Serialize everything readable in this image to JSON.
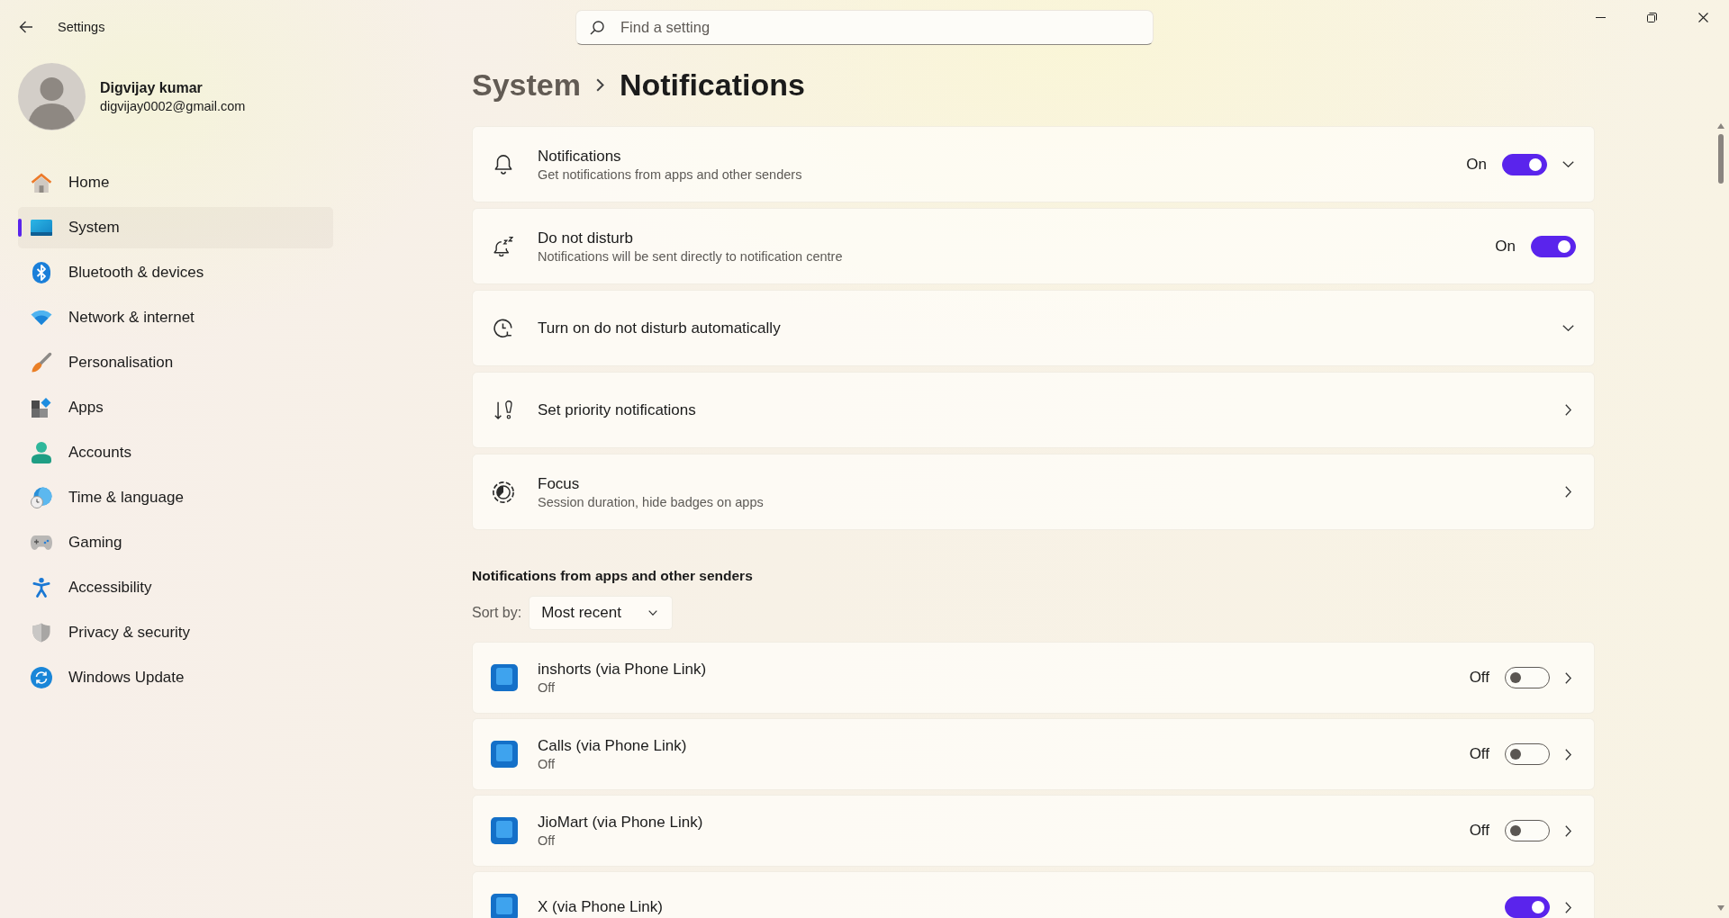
{
  "window": {
    "title": "Settings"
  },
  "search": {
    "placeholder": "Find a setting"
  },
  "account": {
    "name": "Digvijay kumar",
    "email": "digvijay0002@gmail.com"
  },
  "sidebar": {
    "items": [
      {
        "label": "Home",
        "selected": false
      },
      {
        "label": "System",
        "selected": true
      },
      {
        "label": "Bluetooth & devices",
        "selected": false
      },
      {
        "label": "Network & internet",
        "selected": false
      },
      {
        "label": "Personalisation",
        "selected": false
      },
      {
        "label": "Apps",
        "selected": false
      },
      {
        "label": "Accounts",
        "selected": false
      },
      {
        "label": "Time & language",
        "selected": false
      },
      {
        "label": "Gaming",
        "selected": false
      },
      {
        "label": "Accessibility",
        "selected": false
      },
      {
        "label": "Privacy & security",
        "selected": false
      },
      {
        "label": "Windows Update",
        "selected": false
      }
    ]
  },
  "breadcrumb": {
    "parent": "System",
    "current": "Notifications"
  },
  "settings": [
    {
      "kind": "toggle",
      "title": "Notifications",
      "description": "Get notifications from apps and other senders",
      "state_label": "On",
      "on": true,
      "expanded": false
    },
    {
      "kind": "toggle",
      "title": "Do not disturb",
      "description": "Notifications will be sent directly to notification centre",
      "state_label": "On",
      "on": true
    },
    {
      "kind": "expander",
      "title": "Turn on do not disturb automatically",
      "expanded": false
    },
    {
      "kind": "link",
      "title": "Set priority notifications"
    },
    {
      "kind": "link",
      "title": "Focus",
      "description": "Session duration, hide badges on apps"
    }
  ],
  "app_senders": {
    "heading": "Notifications from apps and other senders",
    "sort_label": "Sort by:",
    "sort_value": "Most recent",
    "apps": [
      {
        "name": "inshorts (via Phone Link)",
        "status": "Off",
        "state_label": "Off",
        "on": false
      },
      {
        "name": "Calls (via Phone Link)",
        "status": "Off",
        "state_label": "Off",
        "on": false
      },
      {
        "name": "JioMart (via Phone Link)",
        "status": "Off",
        "state_label": "Off",
        "on": false
      },
      {
        "name": "X (via Phone Link)",
        "on": true
      }
    ]
  }
}
